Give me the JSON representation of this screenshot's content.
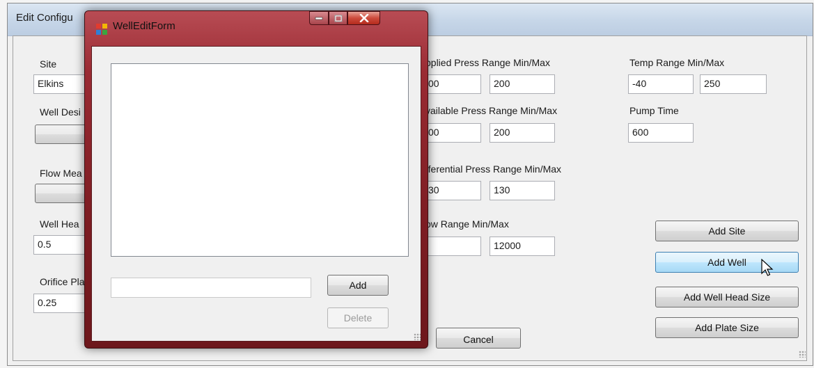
{
  "main_window": {
    "title": "Edit Configu",
    "left_labels": {
      "site": "Site",
      "well_design": "Well Desi",
      "flow_meas": "Flow Mea",
      "well_head": "Well Hea",
      "orifice_plate": "Orifice Pla"
    },
    "left_values": {
      "site": "Elkins",
      "well_head": "0.5",
      "orifice_plate": "0.25"
    },
    "applied_press": {
      "label": "pplied Press Range Min/Max",
      "min": "00",
      "max": "200"
    },
    "available_press": {
      "label": "vailable Press Range Min/Max",
      "min": "00",
      "max": "200"
    },
    "differential_press": {
      "label": "fferential Press Range Min/Max",
      "min": "30",
      "max": "130"
    },
    "flow_range": {
      "label": "ow Range Min/Max",
      "min": "",
      "max": "12000"
    },
    "temp_range": {
      "label": "Temp Range Min/Max",
      "min": "-40",
      "max": "250"
    },
    "pump_time": {
      "label": "Pump Time",
      "value": "600"
    },
    "buttons": {
      "add_site": "Add Site",
      "add_well": "Add Well",
      "add_well_head_size": "Add Well Head Size",
      "add_plate_size": "Add Plate Size",
      "cancel": "Cancel"
    }
  },
  "dialog": {
    "title": "WellEditForm",
    "input_value": "",
    "add_label": "Add",
    "delete_label": "Delete"
  },
  "colors": {
    "dialog_frame": "#8e2a31",
    "close_button": "#c8423a",
    "hover_button": "#bee6fd"
  },
  "icons": [
    "app-icon",
    "minimize-icon",
    "maximize-icon",
    "close-icon",
    "mouse-cursor-icon",
    "resize-grip-icon"
  ]
}
